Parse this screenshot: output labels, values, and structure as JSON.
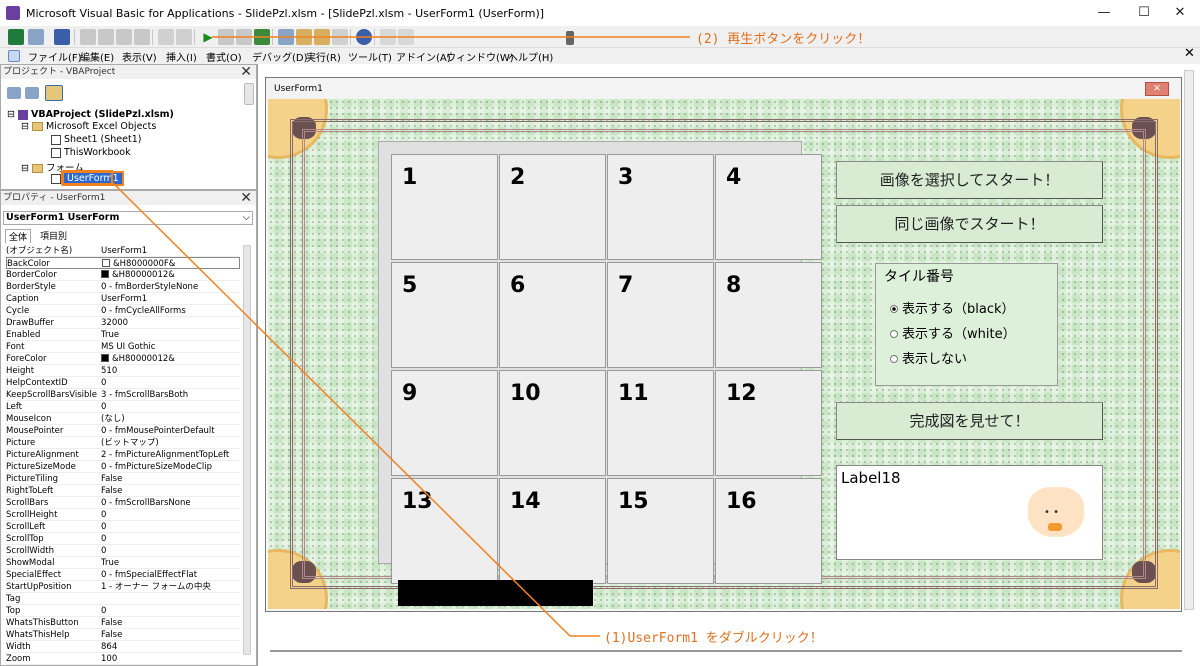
{
  "window": {
    "title": "Microsoft Visual Basic for Applications - SlidePzl.xlsm - [SlidePzl.xlsm - UserForm1 (UserForm)]",
    "minimize": "—",
    "maximize": "☐",
    "close": "✕"
  },
  "menu": [
    "ファイル(F)",
    "編集(E)",
    "表示(V)",
    "挿入(I)",
    "書式(O)",
    "デバッグ(D)",
    "実行(R)",
    "ツール(T)",
    "アドイン(A)",
    "ウィンドウ(W)",
    "ヘルプ(H)"
  ],
  "project": {
    "header": "プロジェクト - VBAProject",
    "root": "VBAProject (SlidePzl.xlsm)",
    "excel_objects": "Microsoft Excel Objects",
    "sheet1": "Sheet1 (Sheet1)",
    "thisworkbook": "ThisWorkbook",
    "forms": "フォーム",
    "userform": "UserForm1"
  },
  "properties": {
    "header": "プロパティ - UserForm1",
    "object_select": "UserForm1 UserForm",
    "tab_all": "全体",
    "tab_category": "項目別",
    "rows": [
      {
        "k": "(オブジェクト名)",
        "v": "UserForm1"
      },
      {
        "k": "BackColor",
        "v": "&H8000000F&"
      },
      {
        "k": "BorderColor",
        "v": "&H80000012&"
      },
      {
        "k": "BorderStyle",
        "v": "0 - fmBorderStyleNone"
      },
      {
        "k": "Caption",
        "v": "UserForm1"
      },
      {
        "k": "Cycle",
        "v": "0 - fmCycleAllForms"
      },
      {
        "k": "DrawBuffer",
        "v": "32000"
      },
      {
        "k": "Enabled",
        "v": "True"
      },
      {
        "k": "Font",
        "v": "MS UI Gothic"
      },
      {
        "k": "ForeColor",
        "v": "&H80000012&"
      },
      {
        "k": "Height",
        "v": "510"
      },
      {
        "k": "HelpContextID",
        "v": "0"
      },
      {
        "k": "KeepScrollBarsVisible",
        "v": "3 - fmScrollBarsBoth"
      },
      {
        "k": "Left",
        "v": "0"
      },
      {
        "k": "MouseIcon",
        "v": "(なし)"
      },
      {
        "k": "MousePointer",
        "v": "0 - fmMousePointerDefault"
      },
      {
        "k": "Picture",
        "v": "(ビットマップ)"
      },
      {
        "k": "PictureAlignment",
        "v": "2 - fmPictureAlignmentTopLeft"
      },
      {
        "k": "PictureSizeMode",
        "v": "0 - fmPictureSizeModeClip"
      },
      {
        "k": "PictureTiling",
        "v": "False"
      },
      {
        "k": "RightToLeft",
        "v": "False"
      },
      {
        "k": "ScrollBars",
        "v": "0 - fmScrollBarsNone"
      },
      {
        "k": "ScrollHeight",
        "v": "0"
      },
      {
        "k": "ScrollLeft",
        "v": "0"
      },
      {
        "k": "ScrollTop",
        "v": "0"
      },
      {
        "k": "ScrollWidth",
        "v": "0"
      },
      {
        "k": "ShowModal",
        "v": "True"
      },
      {
        "k": "SpecialEffect",
        "v": "0 - fmSpecialEffectFlat"
      },
      {
        "k": "StartUpPosition",
        "v": "1 - オーナー フォームの中央"
      },
      {
        "k": "Tag",
        "v": ""
      },
      {
        "k": "Top",
        "v": "0"
      },
      {
        "k": "WhatsThisButton",
        "v": "False"
      },
      {
        "k": "WhatsThisHelp",
        "v": "False"
      },
      {
        "k": "Width",
        "v": "864"
      },
      {
        "k": "Zoom",
        "v": "100"
      }
    ]
  },
  "form": {
    "caption": "UserForm1",
    "close_glyph": "✕",
    "tiles": [
      "1",
      "2",
      "3",
      "4",
      "5",
      "6",
      "7",
      "8",
      "9",
      "10",
      "11",
      "12",
      "13",
      "14",
      "15",
      "16"
    ],
    "btn_select_start": "画像を選択してスタート！",
    "btn_same_start": "同じ画像でスタート！",
    "group_title": "タイル番号",
    "radio_black": "表示する（black）",
    "radio_white": "表示する（white）",
    "radio_hide": "表示しない",
    "btn_show_complete": "完成図を見せて！",
    "label18": "Label18"
  },
  "annotations": {
    "step2": "(2) 再生ボタンをクリック！",
    "step1": "(1)UserForm1 をダブルクリック！"
  },
  "colors": {
    "accent": "#f08020"
  }
}
